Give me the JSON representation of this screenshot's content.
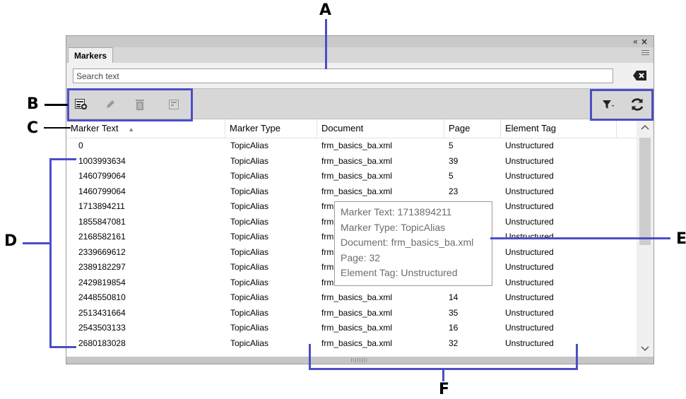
{
  "callouts": {
    "a": "A",
    "b": "B",
    "c": "C",
    "d": "D",
    "e": "E",
    "f": "F"
  },
  "panel": {
    "tab_label": "Markers",
    "window_controls": {
      "collapse": "«",
      "close": "×"
    },
    "search": {
      "placeholder": "Search text",
      "value": ""
    },
    "toolbar_left_icons": [
      "new-marker-icon",
      "edit-pencil-icon",
      "delete-trash-icon",
      "go-to-marker-icon"
    ],
    "toolbar_right_icons": [
      "filter-icon",
      "refresh-icon"
    ]
  },
  "table": {
    "headers": {
      "marker_text": "Marker Text",
      "marker_type": "Marker Type",
      "document": "Document",
      "page": "Page",
      "element_tag": "Element Tag"
    },
    "sort": {
      "column": "marker_text",
      "direction": "ascending"
    },
    "rows": [
      {
        "text": "0",
        "type": "TopicAlias",
        "doc": "frm_basics_ba.xml",
        "page": "5",
        "tag": "Unstructured"
      },
      {
        "text": "1003993634",
        "type": "TopicAlias",
        "doc": "frm_basics_ba.xml",
        "page": "39",
        "tag": "Unstructured"
      },
      {
        "text": "1460799064",
        "type": "TopicAlias",
        "doc": "frm_basics_ba.xml",
        "page": "5",
        "tag": "Unstructured"
      },
      {
        "text": "1460799064",
        "type": "TopicAlias",
        "doc": "frm_basics_ba.xml",
        "page": "23",
        "tag": "Unstructured"
      },
      {
        "text": "1713894211",
        "type": "TopicAlias",
        "doc": "frm",
        "page": "",
        "tag": "Unstructured"
      },
      {
        "text": "1855847081",
        "type": "TopicAlias",
        "doc": "frm",
        "page": "",
        "tag": "Unstructured"
      },
      {
        "text": "2168582161",
        "type": "TopicAlias",
        "doc": "frm",
        "page": "",
        "tag": "Unstructured"
      },
      {
        "text": "2339669612",
        "type": "TopicAlias",
        "doc": "frm",
        "page": "",
        "tag": "Unstructured"
      },
      {
        "text": "2389182297",
        "type": "TopicAlias",
        "doc": "frm",
        "page": "",
        "tag": "Unstructured"
      },
      {
        "text": "2429819854",
        "type": "TopicAlias",
        "doc": "frm",
        "page": "",
        "tag": "Unstructured"
      },
      {
        "text": "2448550810",
        "type": "TopicAlias",
        "doc": "frm_basics_ba.xml",
        "page": "14",
        "tag": "Unstructured"
      },
      {
        "text": "2513431664",
        "type": "TopicAlias",
        "doc": "frm_basics_ba.xml",
        "page": "35",
        "tag": "Unstructured"
      },
      {
        "text": "2543503133",
        "type": "TopicAlias",
        "doc": "frm_basics_ba.xml",
        "page": "16",
        "tag": "Unstructured"
      },
      {
        "text": "2680183028",
        "type": "TopicAlias",
        "doc": "frm_basics_ba.xml",
        "page": "32",
        "tag": "Unstructured"
      }
    ]
  },
  "tooltip": {
    "line1": "Marker Text: 1713894211",
    "line2": "Marker Type: TopicAlias",
    "line3": "Document: frm_basics_ba.xml",
    "line4": "Page: 32",
    "line5": "Element Tag: Unstructured"
  },
  "colors": {
    "annotation": "#4a4fc6",
    "panel_gray": "#d7d7d7",
    "tooltip_text": "#6d6d6d"
  }
}
